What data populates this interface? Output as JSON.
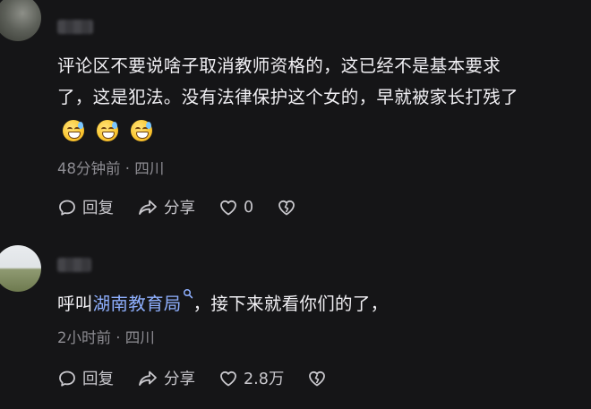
{
  "comments": [
    {
      "text_line1": "评论区不要说啥子取消教师资格的，这已经不是基本要求",
      "text_line2": "了，这是犯法。没有法律保护这个女的，早就被家长打残了",
      "emoji_count": 3,
      "emoji_name": "grinning-sweat-emoji",
      "time": "48分钟前",
      "location": "四川",
      "reply_label": "回复",
      "share_label": "分享",
      "like_count": "0"
    },
    {
      "text_prefix": "呼叫",
      "mention": "湖南教育局",
      "text_suffix": "，接下来就看你们的了，",
      "time": "2小时前",
      "location": "四川",
      "reply_label": "回复",
      "share_label": "分享",
      "like_count": "2.8万"
    }
  ],
  "separator": "·",
  "colors": {
    "background": "#151517",
    "text": "#f1f0f4",
    "meta": "#8d8c92",
    "mention": "#8fb0ff"
  }
}
